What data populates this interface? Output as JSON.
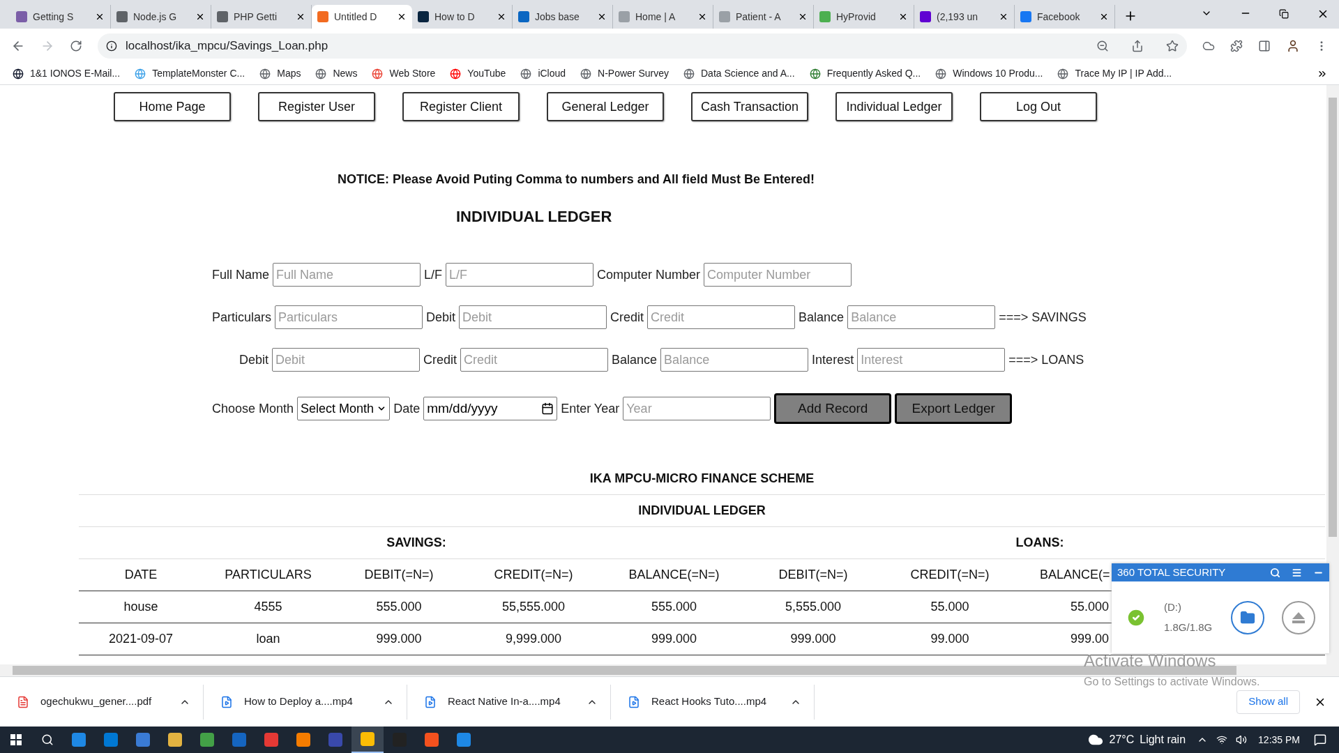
{
  "browser": {
    "tabs": [
      {
        "title": "Getting S",
        "color": "#7b5ea7",
        "selected": false
      },
      {
        "title": "Node.js G",
        "color": "#5f6368",
        "selected": false
      },
      {
        "title": "PHP Getti",
        "color": "#5f6368",
        "selected": false
      },
      {
        "title": "Untitled D",
        "color": "#f26b21",
        "selected": true
      },
      {
        "title": "How to D",
        "color": "#0a2540",
        "selected": false
      },
      {
        "title": "Jobs base",
        "color": "#0a66c2",
        "selected": false
      },
      {
        "title": "Home | A",
        "color": "#9aa0a6",
        "selected": false
      },
      {
        "title": "Patient - A",
        "color": "#9aa0a6",
        "selected": false
      },
      {
        "title": "HyProvid",
        "color": "#4caf50",
        "selected": false
      },
      {
        "title": "(2,193 un",
        "color": "#6001d2",
        "selected": false
      },
      {
        "title": "Facebook",
        "color": "#1877f2",
        "selected": false
      }
    ],
    "url": "localhost/ika_mpcu/Savings_Loan.php",
    "bookmarks": [
      {
        "label": "1&1 IONOS E-Mail...",
        "color": "#11172b"
      },
      {
        "label": "TemplateMonster C...",
        "color": "#3aa0e8"
      },
      {
        "label": "Maps",
        "color": "#5f6368"
      },
      {
        "label": "News",
        "color": "#5f6368"
      },
      {
        "label": "Web Store",
        "color": "#ea4335"
      },
      {
        "label": "YouTube",
        "color": "#ff0000"
      },
      {
        "label": "iCloud",
        "color": "#5f6368"
      },
      {
        "label": "N-Power Survey",
        "color": "#5f6368"
      },
      {
        "label": "Data Science and A...",
        "color": "#5f6368"
      },
      {
        "label": "Frequently Asked Q...",
        "color": "#2e7d32"
      },
      {
        "label": "Windows 10 Produ...",
        "color": "#5f6368"
      },
      {
        "label": "Trace My IP | IP Add...",
        "color": "#5f6368"
      }
    ]
  },
  "nav": [
    "Home Page",
    "Register User",
    "Register Client",
    "General Ledger",
    "Cash Transaction",
    "Individual Ledger",
    "Log Out"
  ],
  "notice": "NOTICE: Please Avoid Puting Comma to numbers and All field Must Be Entered!",
  "form_title": "INDIVIDUAL LEDGER",
  "form_rows": [
    [
      {
        "kind": "label",
        "text": "Full Name"
      },
      {
        "kind": "input",
        "placeholder": "Full Name"
      },
      {
        "kind": "label",
        "text": "L/F"
      },
      {
        "kind": "input",
        "placeholder": "L/F"
      },
      {
        "kind": "label",
        "text": "Computer Number"
      },
      {
        "kind": "input",
        "placeholder": "Computer Number"
      }
    ],
    [
      {
        "kind": "label",
        "text": "Particulars"
      },
      {
        "kind": "input",
        "placeholder": "Particulars"
      },
      {
        "kind": "label",
        "text": "Debit"
      },
      {
        "kind": "input",
        "placeholder": "Debit"
      },
      {
        "kind": "label",
        "text": "Credit"
      },
      {
        "kind": "input",
        "placeholder": "Credit"
      },
      {
        "kind": "label",
        "text": "Balance"
      },
      {
        "kind": "input",
        "placeholder": "Balance"
      },
      {
        "kind": "label",
        "text": "===> SAVINGS"
      }
    ],
    [
      {
        "kind": "label",
        "text": "Debit"
      },
      {
        "kind": "input",
        "placeholder": "Debit"
      },
      {
        "kind": "label",
        "text": "Credit"
      },
      {
        "kind": "input",
        "placeholder": "Credit"
      },
      {
        "kind": "label",
        "text": "Balance"
      },
      {
        "kind": "input",
        "placeholder": "Balance"
      },
      {
        "kind": "label",
        "text": "Interest"
      },
      {
        "kind": "input",
        "placeholder": "Interest"
      },
      {
        "kind": "label",
        "text": "===> LOANS"
      }
    ],
    [
      {
        "kind": "label",
        "text": "Choose Month"
      },
      {
        "kind": "select",
        "value": "Select Month"
      },
      {
        "kind": "label",
        "text": "Date"
      },
      {
        "kind": "date",
        "value": "mm/dd/yyyy"
      },
      {
        "kind": "label",
        "text": "Enter Year"
      },
      {
        "kind": "input",
        "placeholder": "Year"
      },
      {
        "kind": "button",
        "text": "Add Record"
      },
      {
        "kind": "button",
        "text": "Export Ledger"
      }
    ]
  ],
  "table": {
    "title": "IKA MPCU-MICRO FINANCE SCHEME",
    "subtitle": "INDIVIDUAL LEDGER",
    "groups": [
      "SAVINGS:",
      "LOANS:"
    ],
    "columns": [
      "DATE",
      "PARTICULARS",
      "DEBIT(=N=)",
      "CREDIT(=N=)",
      "BALANCE(=N=)",
      "DEBIT(=N=)",
      "CREDIT(=N=)",
      "BALANCE(="
    ],
    "rows": [
      [
        "house",
        "4555",
        "555.000",
        "55,555.000",
        "555.000",
        "5,555.000",
        "55.000",
        "55.000"
      ],
      [
        "2021-09-07",
        "loan",
        "999.000",
        "9,999.000",
        "999.000",
        "999.000",
        "99.000",
        "999.00"
      ]
    ]
  },
  "security_popup": {
    "title": "360 TOTAL SECURITY",
    "drive": "(D:)",
    "usage": "1.8G/1.8G"
  },
  "activation": {
    "title": "Activate Windows",
    "text": "Go to Settings to activate Windows."
  },
  "downloads": {
    "items": [
      {
        "name": "ogechukwu_gener....pdf",
        "kind": "pdf"
      },
      {
        "name": "How to Deploy a....mp4",
        "kind": "video"
      },
      {
        "name": "React Native In-a....mp4",
        "kind": "video"
      },
      {
        "name": "React Hooks Tuto....mp4",
        "kind": "video"
      }
    ],
    "show_all": "Show all"
  },
  "taskbar": {
    "apps": [
      {
        "color": "#1e88e5",
        "selected": false
      },
      {
        "color": "#0078d4",
        "selected": false
      },
      {
        "color": "#3a7bd5",
        "selected": false
      },
      {
        "color": "#e3b341",
        "selected": false
      },
      {
        "color": "#43a047",
        "selected": false
      },
      {
        "color": "#1565c0",
        "selected": false
      },
      {
        "color": "#e53935",
        "selected": false
      },
      {
        "color": "#f57c00",
        "selected": false
      },
      {
        "color": "#3949ab",
        "selected": false
      },
      {
        "color": "#fbbc05",
        "selected": true
      },
      {
        "color": "#222222",
        "selected": false
      },
      {
        "color": "#f4511e",
        "selected": false
      },
      {
        "color": "#1e88e5",
        "selected": false
      }
    ],
    "temperature": "27°C",
    "weather": "Light rain",
    "time": "12:35 PM"
  }
}
